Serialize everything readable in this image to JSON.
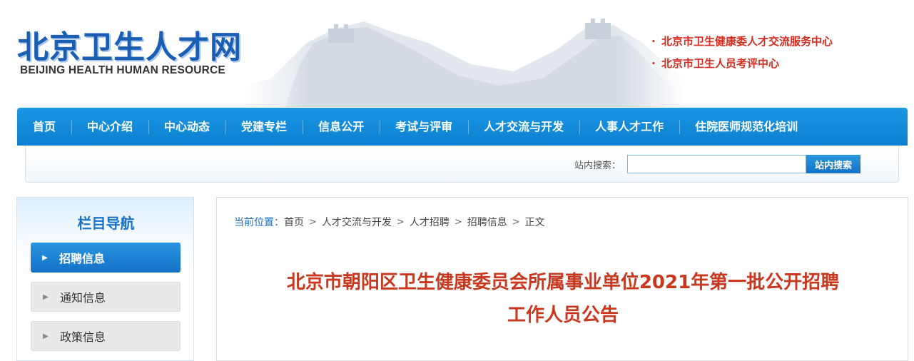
{
  "header": {
    "logo_cn": "北京卫生人才网",
    "logo_en": "BEIJING HEALTH HUMAN RESOURCE",
    "orgs": [
      {
        "bullet": "·",
        "label": "北京市卫生健康委人才交流服务中心"
      },
      {
        "bullet": "·",
        "label": "北京市卫生人员考评中心"
      }
    ]
  },
  "nav": {
    "items": [
      "首页",
      "中心介绍",
      "中心动态",
      "党建专栏",
      "信息公开",
      "考试与评审",
      "人才交流与开发",
      "人事人才工作",
      "住院医师规范化培训"
    ]
  },
  "search": {
    "label": "站内搜索：",
    "value": "",
    "button": "站内搜索"
  },
  "sidebar": {
    "title": "栏目导航",
    "items": [
      {
        "label": "招聘信息",
        "active": true
      },
      {
        "label": "通知信息",
        "active": false
      },
      {
        "label": "政策信息",
        "active": false
      }
    ]
  },
  "breadcrumb": {
    "label": "当前位置：",
    "items": [
      "首页",
      "人才交流与开发",
      "人才招聘",
      "招聘信息",
      "正文"
    ],
    "separator": ">"
  },
  "article": {
    "title_line1": "北京市朝阳区卫生健康委员会所属事业单位2021年第一批公开招聘",
    "title_line2": "工作人员公告"
  },
  "colors": {
    "nav_blue": "#0c7fd1",
    "org_red": "#d62b1f",
    "title_red": "#c9381e",
    "logo_blue": "#1a5fb4"
  }
}
